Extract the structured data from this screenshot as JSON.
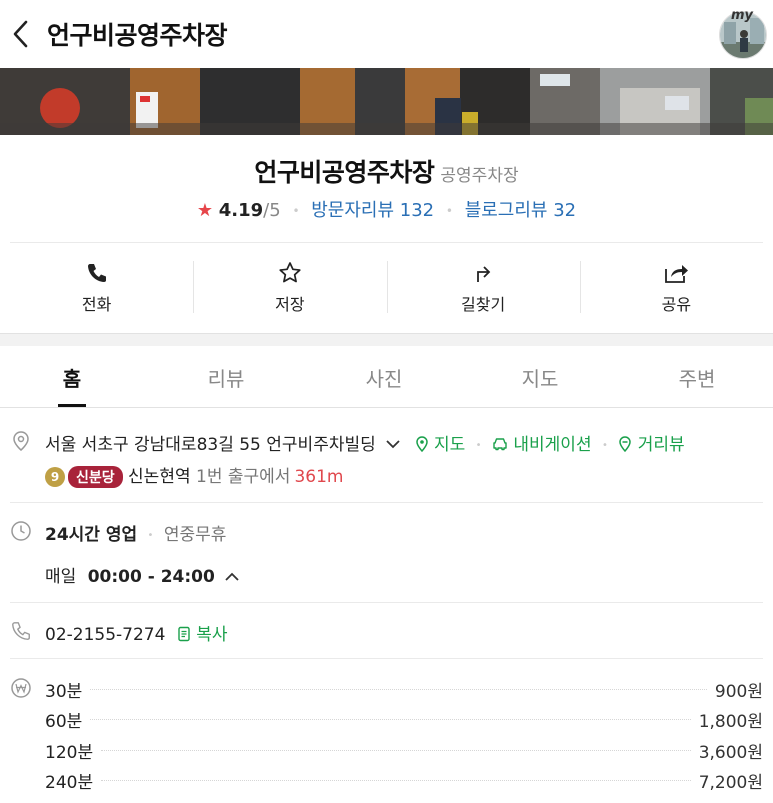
{
  "header": {
    "title": "언구비공영주차장",
    "avatar_badge": "my"
  },
  "place": {
    "name": "언구비공영주차장",
    "category": "공영주차장",
    "rating": "4.19",
    "rating_max": "/5",
    "visitor_reviews": "방문자리뷰 132",
    "blog_reviews": "블로그리뷰 32"
  },
  "actions": [
    {
      "label": "전화",
      "icon": "phone-icon"
    },
    {
      "label": "저장",
      "icon": "star-icon"
    },
    {
      "label": "길찾기",
      "icon": "directions-icon"
    },
    {
      "label": "공유",
      "icon": "share-icon"
    }
  ],
  "tabs": [
    {
      "label": "홈",
      "active": true
    },
    {
      "label": "리뷰",
      "active": false
    },
    {
      "label": "사진",
      "active": false
    },
    {
      "label": "지도",
      "active": false
    },
    {
      "label": "주변",
      "active": false
    }
  ],
  "address": {
    "text": "서울 서초구 강남대로83길 55 언구비주차빌딩",
    "map_link": "지도",
    "navigation_link": "내비게이션",
    "street_view_link": "거리뷰"
  },
  "transit": {
    "line_number": "9",
    "line_name": "신분당",
    "station": "신논현역",
    "exit": "1번 출구에서",
    "distance": "361m"
  },
  "hours": {
    "status": "24시간 영업",
    "holiday": "연중무휴",
    "day": "매일",
    "time": "00:00 - 24:00"
  },
  "phone": {
    "number": "02-2155-7274",
    "copy_label": "복사"
  },
  "fees": [
    {
      "duration": "30분",
      "price": "900원"
    },
    {
      "duration": "60분",
      "price": "1,800원"
    },
    {
      "duration": "120분",
      "price": "3,600원"
    },
    {
      "duration": "240분",
      "price": "7,200원"
    }
  ],
  "colors": {
    "accent_green": "#1aa04b",
    "link_blue": "#2a6fb5",
    "star_red": "#e6454a",
    "line9_gold": "#bfa045",
    "sinbundang_red": "#a8233a"
  }
}
